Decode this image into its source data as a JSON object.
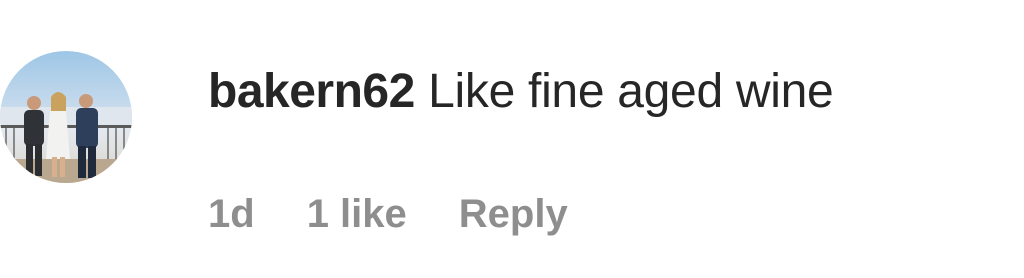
{
  "comment": {
    "username": "bakern62",
    "text": "Like fine aged wine",
    "timestamp": "1d",
    "likes": "1 like",
    "reply_label": "Reply"
  },
  "avatar": {
    "description_icon": "profile-photo-avatar"
  }
}
